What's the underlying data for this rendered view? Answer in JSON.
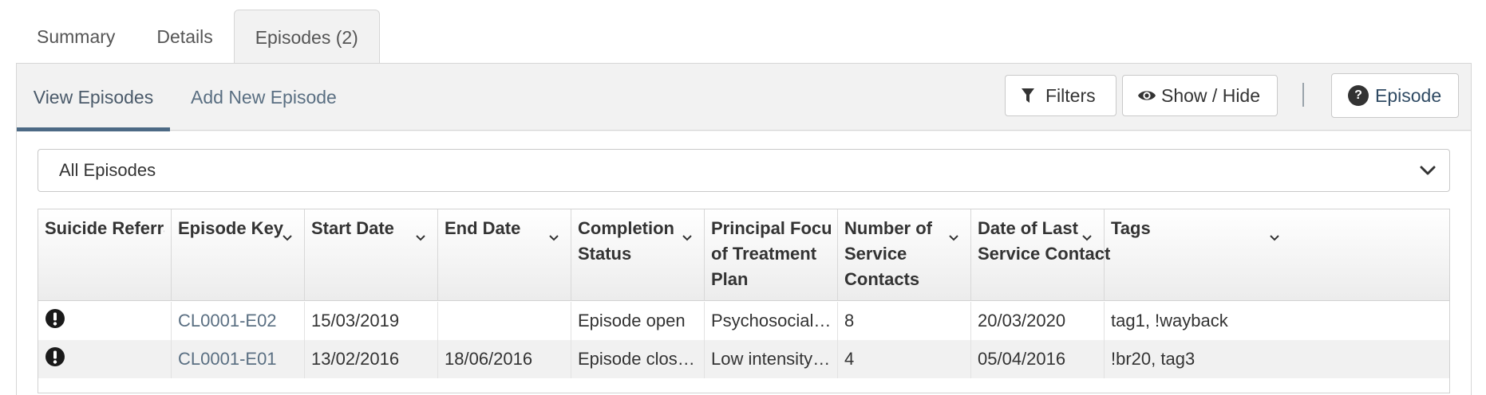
{
  "top_tabs": [
    {
      "label": "Summary"
    },
    {
      "label": "Details"
    },
    {
      "label": "Episodes (2)"
    }
  ],
  "subnav": {
    "view_label": "View Episodes",
    "add_label": "Add New Episode"
  },
  "toolbar": {
    "filters_label": "Filters",
    "show_hide_label": "Show / Hide",
    "separator": "|",
    "episode_help_label": "Episode",
    "help_icon_glyph": "?"
  },
  "episode_filter": {
    "selected": "All Episodes"
  },
  "columns": [
    {
      "line1": "Suicide Referral",
      "line2": "",
      "line3": ""
    },
    {
      "line1": "Episode Key",
      "line2": "",
      "line3": ""
    },
    {
      "line1": "Start Date",
      "line2": "",
      "line3": ""
    },
    {
      "line1": "End Date",
      "line2": "",
      "line3": ""
    },
    {
      "line1": "Completion",
      "line2": "Status",
      "line3": ""
    },
    {
      "line1": "Principal Focus",
      "line2": "of Treatment",
      "line3": "Plan"
    },
    {
      "line1": "Number of",
      "line2": "Service",
      "line3": "Contacts"
    },
    {
      "line1": "Date of Last",
      "line2": "Service Contact",
      "line3": ""
    },
    {
      "line1": "Tags",
      "line2": "",
      "line3": ""
    }
  ],
  "rows": [
    {
      "suicide_icon": "exclamation-circle-icon",
      "episode_key": "CL0001-E02",
      "start_date": "15/03/2019",
      "end_date": "",
      "completion_status": "Episode open",
      "principal_focus": "Psychosocial Su...",
      "num_contacts": "8",
      "last_contact": "20/03/2020",
      "tags": "tag1, !wayback"
    },
    {
      "suicide_icon": "exclamation-circle-icon",
      "episode_key": "CL0001-E01",
      "start_date": "13/02/2016",
      "end_date": "18/06/2016",
      "completion_status": "Episode closed ...",
      "principal_focus": "Low intensity ps...",
      "num_contacts": "4",
      "last_contact": "05/04/2016",
      "tags": "!br20, tag3"
    }
  ],
  "colors": {
    "accent": "#4d6a85",
    "link": "#5a6f82",
    "panel_bg": "#f2f2f2"
  }
}
